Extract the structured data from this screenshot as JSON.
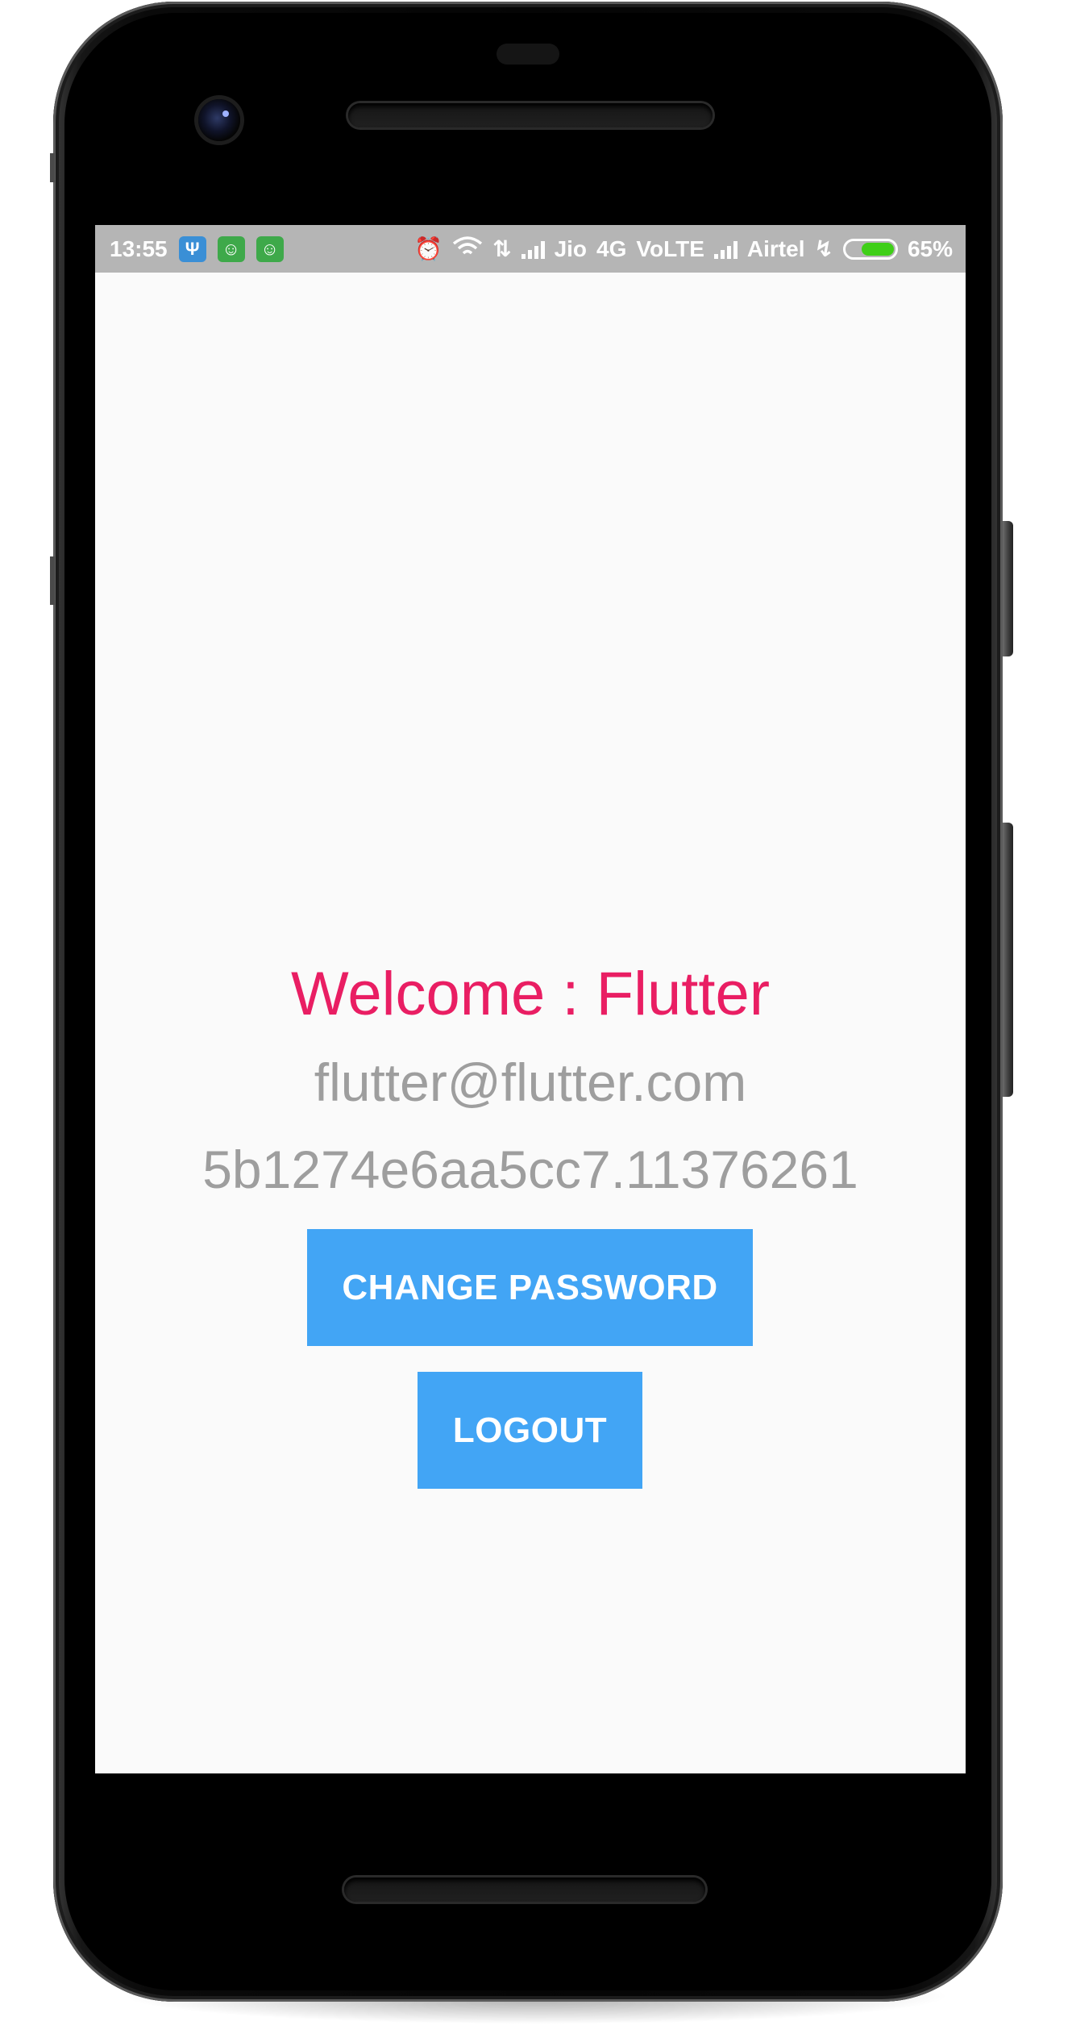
{
  "status_bar": {
    "time": "13:55",
    "notification_icons": [
      "usb-icon",
      "android-icon",
      "android-icon"
    ],
    "carrier_1": "Jio",
    "network_1": "4G",
    "volte": "VoLTE",
    "carrier_2": "Airtel",
    "battery_percent_text": "65%",
    "battery_level": 0.65,
    "battery_color": "#3fcf18"
  },
  "home": {
    "welcome": "Welcome : Flutter",
    "email": "flutter@flutter.com",
    "unique_id": "5b1274e6aa5cc7.11376261"
  },
  "buttons": {
    "change_password": "CHANGE PASSWORD",
    "logout": "LOGOUT"
  },
  "colors": {
    "accent": "#e91e63",
    "button": "#42a5f5",
    "secondary_text": "#9e9e9e",
    "background": "#fafafa"
  }
}
